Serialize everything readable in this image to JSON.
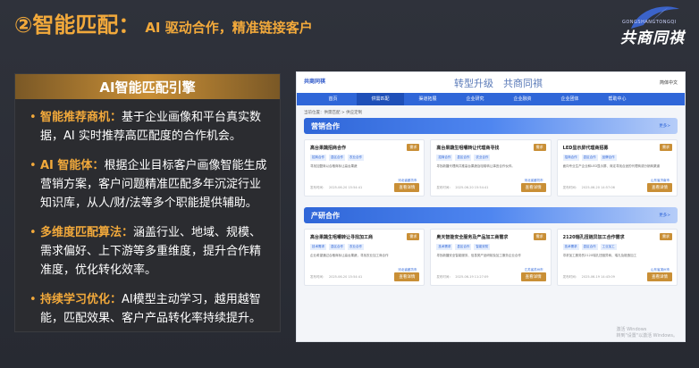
{
  "slide": {
    "title_main": "②智能匹配：",
    "title_sub": "AI 驱动合作，精准链接客户"
  },
  "logo": {
    "small": "GONGSHANGTONGQI",
    "text": "共商同祺"
  },
  "panel": {
    "heading": "AI智能匹配引擎",
    "bullets": [
      {
        "key": "智能推荐商机：",
        "text": "基于企业画像和平台真实数据，AI 实时推荐高匹配度的合作机会。"
      },
      {
        "key": "AI 智能体：",
        "text": "根据企业目标客户画像智能生成营销方案，客户问题精准匹配多年沉淀行业知识库，从人/财/法等多个职能提供辅助。"
      },
      {
        "key": "多维度匹配算法：",
        "text": "涵盖行业、地域、规模、需求偏好、上下游等多重维度，提升合作精准度，优化转化效率。"
      },
      {
        "key": "持续学习优化：",
        "text": "AI模型主动学习，越用越智能，匹配效果、客户产品转化率持续提升。"
      }
    ]
  },
  "screenshot": {
    "logo": "共商同祺",
    "title": "转型升级　共商同祺",
    "user": "简体中文",
    "nav": [
      "首页",
      "供需匹配",
      "渠道拓展",
      "企业研究",
      "企业融资",
      "企业团体",
      "帮助中心"
    ],
    "nav_active": 1,
    "breadcrumb": "当前位置：供需匹配 > 供应定制",
    "sections": [
      {
        "title": "营销合作",
        "more": "更多>",
        "cards": [
          {
            "title": "高台果蔬招商合作",
            "badge": "需求",
            "tags": [
              "招商合作",
              "县区合作",
              "农业合作"
            ],
            "desc": "寻找加盟商以合格商标让高台果蔬",
            "location": "河北省廊坊市",
            "date": "发布时间：　2025-06-20 15:54:41",
            "button": "查看详情"
          },
          {
            "title": "高台果蔬生咀嚼转让代理商寻找",
            "badge": "需求",
            "tags": [
              "招商合作",
              "县区合作",
              "农业合作"
            ],
            "desc": "寻找新疆代理商共推高台果蔬及咀嚼转让事宜合作伙伴。",
            "location": "河北省廊坊市",
            "date": "发布时间：　2025-06-20 15:54:41",
            "button": "查看详情"
          },
          {
            "title": "LED显示屏代理商招募",
            "badge": "需求",
            "tags": [
              "招商合作",
              "县区合作",
              "品牌合作"
            ],
            "desc": "面向专业生产企业和LED显示屏、商定寻找合适的代理商或分销商渠道",
            "location": "山东省济南市",
            "date": "发布时间：　2025-06-20 14:57:06",
            "button": "查看详情"
          }
        ]
      },
      {
        "title": "产研合作",
        "more": "更多>",
        "cards": [
          {
            "title": "高台果蔬生咀嚼转让寻找加工商",
            "badge": "需求",
            "tags": [
              "技术需求",
              "县区合作",
              "农业合作"
            ],
            "desc": "企业希望通过合格商标让高台果蔬，寻找农业加工商合作",
            "location": "河北省廊坊市",
            "date": "发布时间：　2025-06-20 15:54:41",
            "button": "查看详情"
          },
          {
            "title": "奥天智能安全服务及产品加工商需求",
            "badge": "需求",
            "tags": [
              "技术需求",
              "县区合作",
              "智能安防"
            ],
            "desc": "寻找新疆安全智能服务、信息类产品研制及加工服务企业合作",
            "location": "江苏省苏州市",
            "date": "发布时间：　2025-06-19 11:27:09",
            "button": "查看详情"
          },
          {
            "title": "2120瑞孔扭链异加工合作需求",
            "badge": "需求",
            "tags": [
              "技术需求",
              "县区合作",
              "工业加工"
            ],
            "desc": "寻求加工服务的2120瑞孔扭链异商、瑞孔及锻造加工",
            "location": "山东省滨州市",
            "date": "发布时间：　2025-06-19 14:43:09",
            "button": "查看详情"
          }
        ]
      }
    ],
    "watermark_line1": "激活 Windows",
    "watermark_line2": "转到\"设置\"以激活 Windows。"
  }
}
